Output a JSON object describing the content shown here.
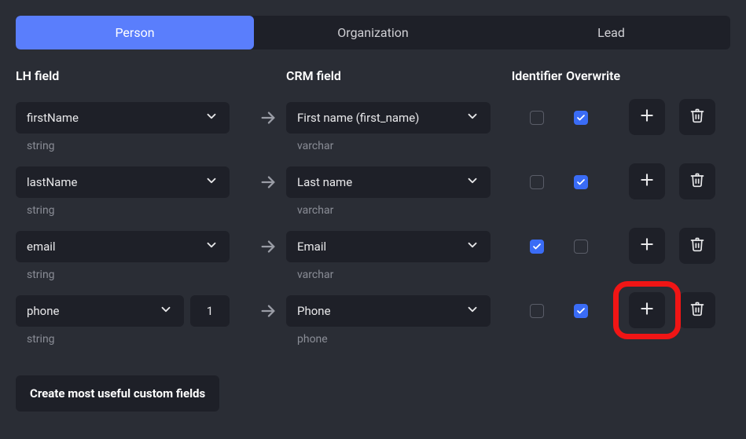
{
  "tabs": [
    {
      "label": "Person",
      "active": true
    },
    {
      "label": "Organization",
      "active": false
    },
    {
      "label": "Lead",
      "active": false
    }
  ],
  "headers": {
    "lh": "LH field",
    "crm": "CRM field",
    "id": "Identifier",
    "ow": "Overwrite"
  },
  "rows": [
    {
      "lh": "firstName",
      "lh_type": "string",
      "crm": "First name (first_name)",
      "crm_type": "varchar",
      "identifier": false,
      "overwrite": true,
      "num": null
    },
    {
      "lh": "lastName",
      "lh_type": "string",
      "crm": "Last name",
      "crm_type": "varchar",
      "identifier": false,
      "overwrite": true,
      "num": null
    },
    {
      "lh": "email",
      "lh_type": "string",
      "crm": "Email",
      "crm_type": "varchar",
      "identifier": true,
      "overwrite": false,
      "num": null
    },
    {
      "lh": "phone",
      "lh_type": "string",
      "crm": "Phone",
      "crm_type": "phone",
      "identifier": false,
      "overwrite": true,
      "num": "1"
    }
  ],
  "create_button": "Create most useful custom fields",
  "highlight_row": 3
}
